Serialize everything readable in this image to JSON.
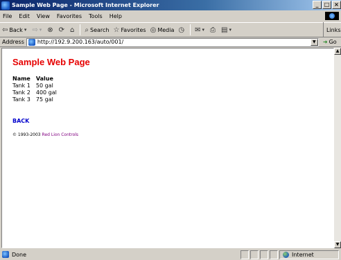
{
  "window": {
    "title": "Sample Web Page - Microsoft Internet Explorer",
    "buttons": {
      "minimize": "_",
      "maximize": "□",
      "close": "×"
    }
  },
  "menu": {
    "items": [
      {
        "label": "File"
      },
      {
        "label": "Edit"
      },
      {
        "label": "View"
      },
      {
        "label": "Favorites"
      },
      {
        "label": "Tools"
      },
      {
        "label": "Help"
      }
    ]
  },
  "toolbar": {
    "back_label": "Back",
    "search_label": "Search",
    "favorites_label": "Favorites",
    "media_label": "Media",
    "links_label": "Links"
  },
  "address": {
    "label": "Address",
    "url": "http://192.9.200.163/auto/001/",
    "go_label": "Go"
  },
  "page": {
    "title": "Sample Web Page",
    "table": {
      "headers": [
        "Name",
        "Value"
      ],
      "rows": [
        [
          "Tank 1",
          "50 gal"
        ],
        [
          "Tank 2",
          "400 gal"
        ],
        [
          "Tank 3",
          "75 gal"
        ]
      ]
    },
    "back_link": "BACK",
    "footer_copyright": "© 1993-2003",
    "footer_brand": "Red Lion Controls"
  },
  "status": {
    "text": "Done",
    "zone": "Internet"
  }
}
